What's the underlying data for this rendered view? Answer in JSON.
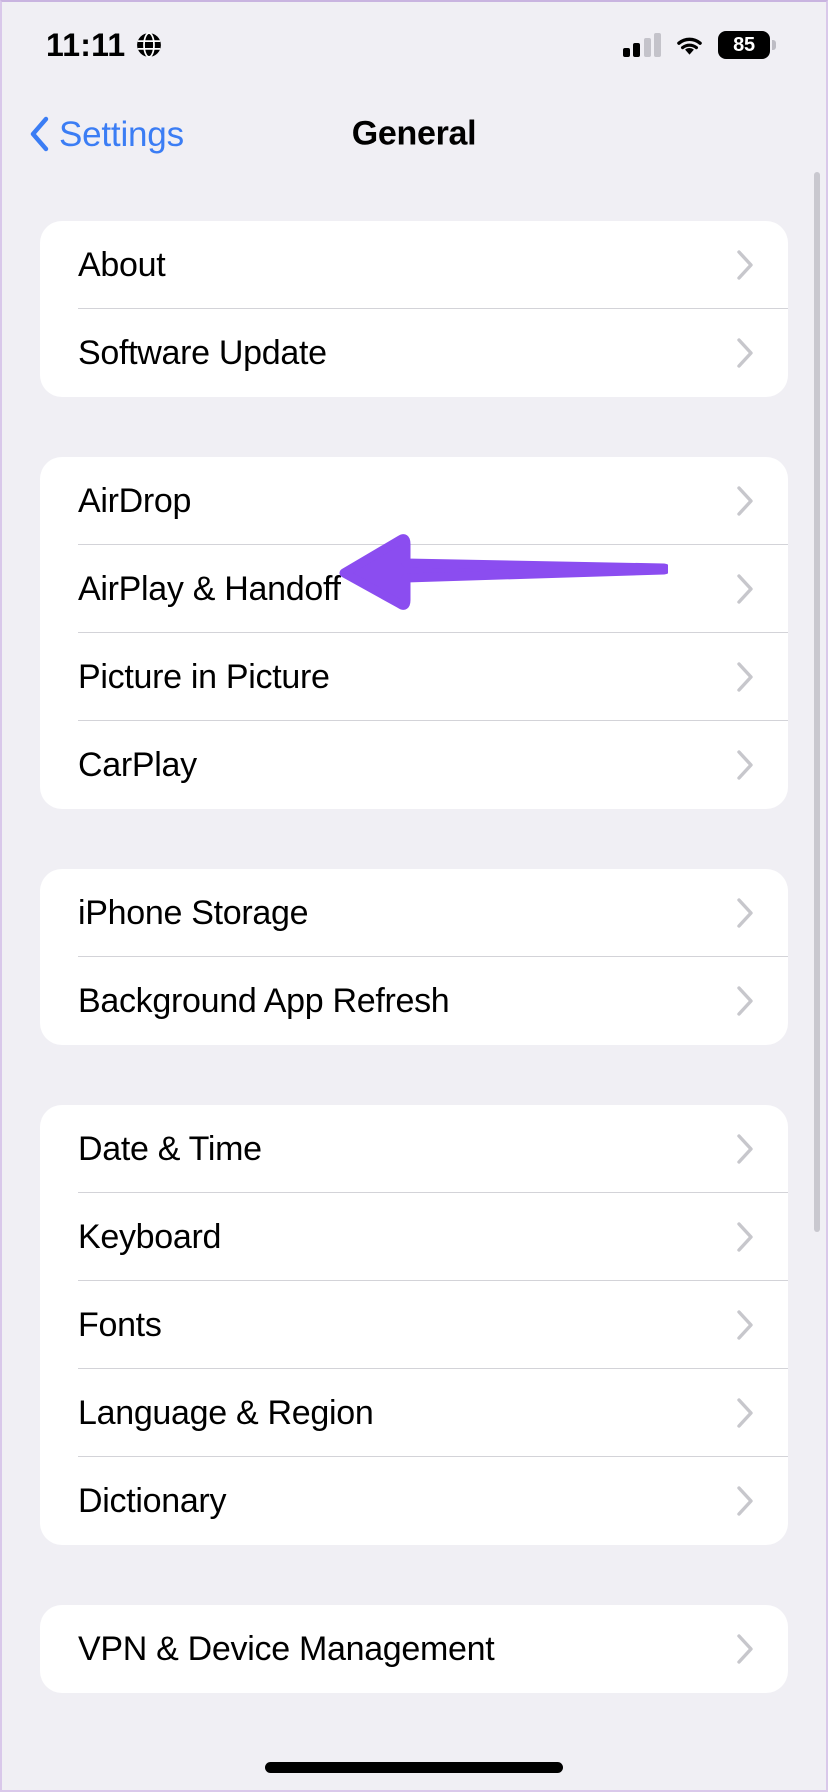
{
  "status_bar": {
    "time": "11:11",
    "location_icon": "globe-icon",
    "signal_icon": "cellular-signal-icon",
    "wifi_icon": "wifi-icon",
    "battery_percent": "85",
    "battery_icon": "battery-icon"
  },
  "nav": {
    "back_label": "Settings",
    "back_icon": "chevron-left-icon",
    "title": "General"
  },
  "groups": [
    {
      "rows": [
        {
          "label": "About",
          "chevron": "chevron-right-icon"
        },
        {
          "label": "Software Update",
          "chevron": "chevron-right-icon"
        }
      ]
    },
    {
      "rows": [
        {
          "label": "AirDrop",
          "chevron": "chevron-right-icon"
        },
        {
          "label": "AirPlay & Handoff",
          "chevron": "chevron-right-icon"
        },
        {
          "label": "Picture in Picture",
          "chevron": "chevron-right-icon"
        },
        {
          "label": "CarPlay",
          "chevron": "chevron-right-icon"
        }
      ]
    },
    {
      "rows": [
        {
          "label": "iPhone Storage",
          "chevron": "chevron-right-icon"
        },
        {
          "label": "Background App Refresh",
          "chevron": "chevron-right-icon"
        }
      ]
    },
    {
      "rows": [
        {
          "label": "Date & Time",
          "chevron": "chevron-right-icon"
        },
        {
          "label": "Keyboard",
          "chevron": "chevron-right-icon"
        },
        {
          "label": "Fonts",
          "chevron": "chevron-right-icon"
        },
        {
          "label": "Language & Region",
          "chevron": "chevron-right-icon"
        },
        {
          "label": "Dictionary",
          "chevron": "chevron-right-icon"
        }
      ]
    },
    {
      "rows": [
        {
          "label": "VPN & Device Management",
          "chevron": "chevron-right-icon"
        }
      ]
    }
  ],
  "annotation": {
    "type": "arrow-left",
    "points_at": "AirPlay & Handoff",
    "color": "#8B4DF0"
  },
  "colors": {
    "background": "#F0EFF4",
    "card": "#FFFFFF",
    "separator": "#D3D3D8",
    "accent_blue": "#3B7DF4",
    "chevron_gray": "#C7C7CC",
    "annotation_purple": "#8B4DF0"
  }
}
